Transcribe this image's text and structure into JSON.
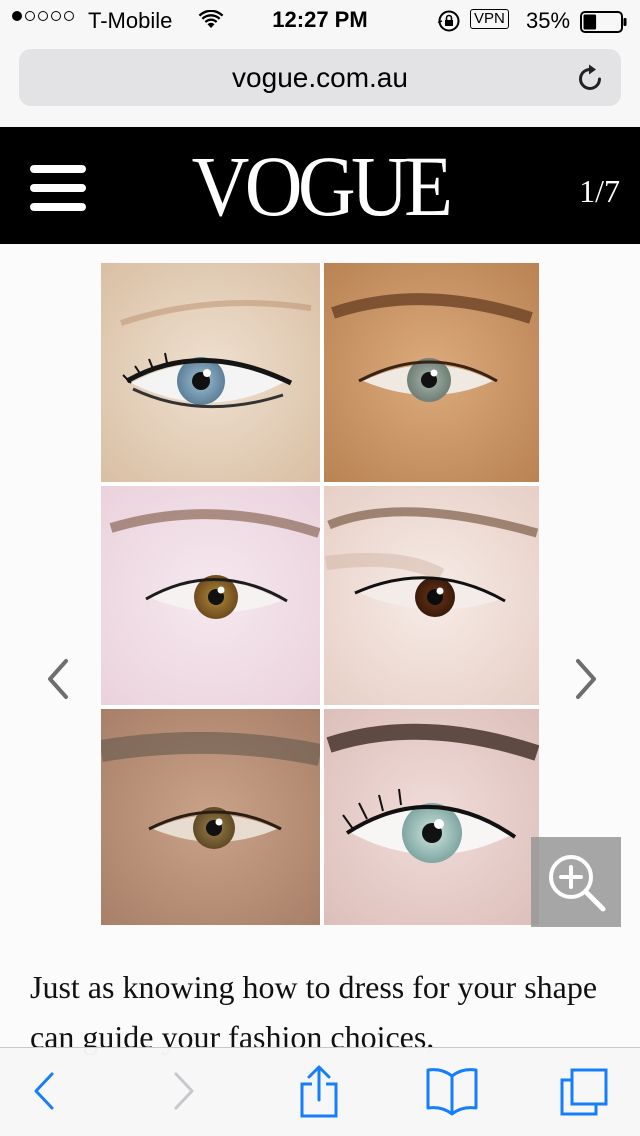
{
  "status_bar": {
    "carrier": "T-Mobile",
    "time": "12:27 PM",
    "vpn": "VPN",
    "battery_percent": "35%",
    "battery_level": 0.35,
    "signal_bars_filled": 1,
    "signal_bars_total": 5
  },
  "browser": {
    "url": "vogue.com.au"
  },
  "header": {
    "logo": "VOGUE",
    "slide_counter": "1/7"
  },
  "gallery": {
    "image_description": "Six close-up eyes showing different eye shapes",
    "accent_color": "#000000"
  },
  "article": {
    "text": "Just as knowing how to dress for your shape can guide your fashion choices,"
  },
  "toolbar": {
    "accent_color": "#157efb",
    "disabled_color": "#c7c7cc",
    "icons": [
      "back-icon",
      "forward-icon",
      "share-icon",
      "bookmarks-icon",
      "tabs-icon"
    ]
  }
}
